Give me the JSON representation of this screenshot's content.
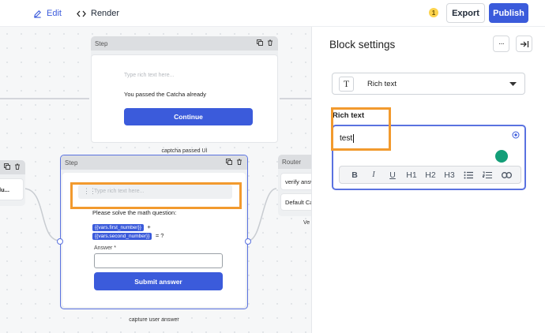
{
  "toolbar": {
    "edit_label": "Edit",
    "render_label": "Render",
    "notification_count": "1",
    "export_label": "Export",
    "publish_label": "Publish"
  },
  "canvas": {
    "top_group": {
      "title": "Step",
      "placeholder": "Type rich text here...",
      "text": "You passed the Catcha already",
      "button": "Continue",
      "caption": "captcha passed UI"
    },
    "left_group": {
      "item_text": "lu..."
    },
    "main_group": {
      "title": "Step",
      "placeholder": "Type rich text here...",
      "question": "Please solve the math question:",
      "var1": "{{vars.first_number}}",
      "plus": "+",
      "var2": "{{vars.second_number}}",
      "equals": "= ?",
      "answer_label": "Answer *",
      "button": "Submit answer",
      "caption": "capture user answer"
    },
    "router": {
      "title": "Router",
      "item1": "verify answ",
      "item2": "Default Ca",
      "caption": "Ve"
    }
  },
  "panel": {
    "title": "Block settings",
    "block_type": "Rich text",
    "field_label": "Rich text",
    "editor_value": "test",
    "format_buttons": [
      "B",
      "I",
      "U",
      "H1",
      "H2",
      "H3"
    ]
  },
  "colors": {
    "accent": "#3b5bdb",
    "highlight": "#f29a2e",
    "canvas_bg": "#f6f7f8"
  }
}
